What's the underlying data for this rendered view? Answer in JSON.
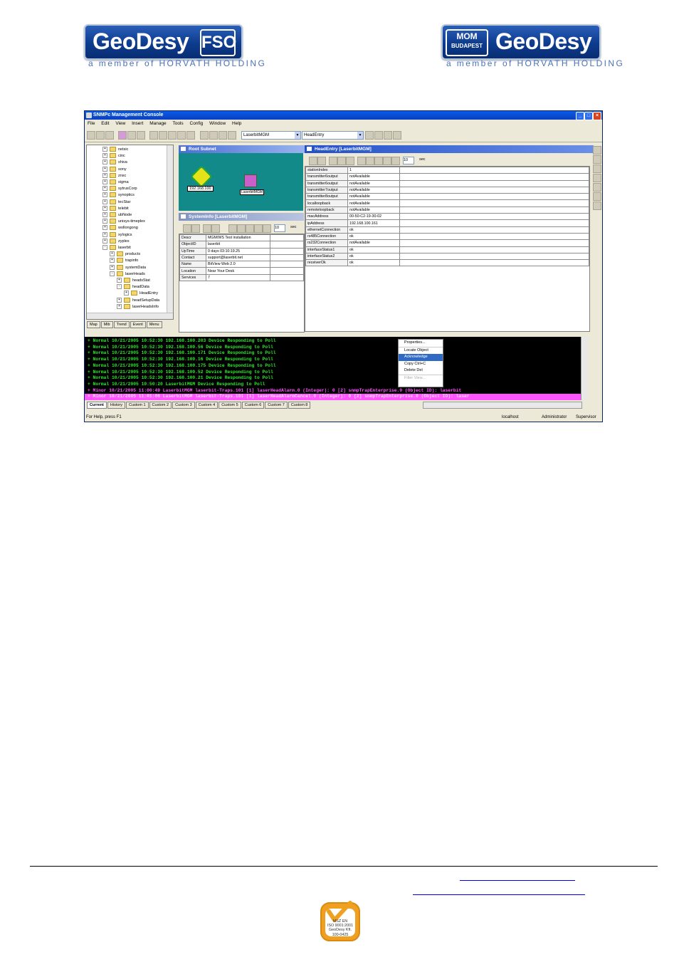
{
  "header": {
    "logo_left": {
      "word": "GeoDesy",
      "box": "FSO",
      "tagline": "a member of HORVATH HOLDING"
    },
    "logo_right": {
      "word": "GeoDesy",
      "box_top": "MOM",
      "box_bottom": "BUDAPEST",
      "tagline": "a member of HORVATH HOLDING"
    }
  },
  "window": {
    "title": "SNMPc Management Console",
    "menu": [
      "File",
      "Edit",
      "View",
      "Insert",
      "Manage",
      "Tools",
      "Config",
      "Window",
      "Help"
    ],
    "combo1": "LaserbitMGM",
    "combo2": "HeadEntry"
  },
  "tree": {
    "items": [
      {
        "label": "netsic",
        "pm": "+"
      },
      {
        "label": "cinc",
        "pm": "+"
      },
      {
        "label": "shiva",
        "pm": "+"
      },
      {
        "label": "sony",
        "pm": "+"
      },
      {
        "label": "znxc",
        "pm": "+"
      },
      {
        "label": "sigma",
        "pm": "+"
      },
      {
        "label": "sytrusCorp",
        "pm": "+"
      },
      {
        "label": "synoptics",
        "pm": "+"
      },
      {
        "label": "tecStar",
        "pm": "+"
      },
      {
        "label": "telebit",
        "pm": "+"
      },
      {
        "label": "ubNode",
        "pm": "+"
      },
      {
        "label": "unisys-timeplex",
        "pm": "+"
      },
      {
        "label": "wollongong",
        "pm": "+"
      },
      {
        "label": "xylogics",
        "pm": "+"
      },
      {
        "label": "zyplex",
        "pm": "+"
      },
      {
        "label": "laserbit",
        "pm": "-"
      },
      {
        "label": "products",
        "pm": "+"
      },
      {
        "label": "trapinfo",
        "pm": "+"
      },
      {
        "label": "systemData",
        "pm": "+"
      },
      {
        "label": "laserHeads",
        "pm": "-"
      },
      {
        "label": "headsStat",
        "pm": "+"
      },
      {
        "label": "headData",
        "pm": "-"
      },
      {
        "label": "HeadEntry",
        "pm": "+"
      },
      {
        "label": "headSetupData",
        "pm": "+"
      },
      {
        "label": "laserHeadsInfo",
        "pm": "+"
      }
    ],
    "tabs": [
      "Map",
      "Mib",
      "Trend",
      "Event",
      "Menu"
    ]
  },
  "root_subnet": {
    "title": "Root Subnet",
    "node1": "192.168.100",
    "node2": "LaserbitMGM"
  },
  "system_info": {
    "title": "SystemInfo [LaserbitMGM]",
    "poll": "10",
    "unit": "sec",
    "rows": [
      {
        "k": "Descr",
        "v": "MGM/WS Test installation"
      },
      {
        "k": "ObjectID",
        "v": "laserbit"
      },
      {
        "k": "UpTime",
        "v": "0 days 03:10:19.25"
      },
      {
        "k": "Contact",
        "v": "support@laserbit.net"
      },
      {
        "k": "Name",
        "v": "BitView Web 2.0"
      },
      {
        "k": "Location",
        "v": "Near Your Desk"
      },
      {
        "k": "Services",
        "v": "7"
      }
    ]
  },
  "head_entry": {
    "title": "HeadEntry [LaserbitMGM]",
    "poll": "10",
    "unit": "sec",
    "rows": [
      {
        "k": "stationIndex",
        "v": "1"
      },
      {
        "k": "transmitter6output",
        "v": "notAvailable"
      },
      {
        "k": "transmitter6output",
        "v": "notAvailable"
      },
      {
        "k": "transmitter7output",
        "v": "notAvailable"
      },
      {
        "k": "transmitter8output",
        "v": "notAvailable"
      },
      {
        "k": "localloopback",
        "v": "notAvailable"
      },
      {
        "k": "remoteloopback",
        "v": "notAvailable"
      },
      {
        "k": "macAddress",
        "v": "00-50-C2-19-30-02"
      },
      {
        "k": "ipAddress",
        "v": "192.168.100.161"
      },
      {
        "k": "ethernetConnection",
        "v": "ok"
      },
      {
        "k": "rs485Connection",
        "v": "ok"
      },
      {
        "k": "rs232Connection",
        "v": "notAvailable"
      },
      {
        "k": "interfaceStatus1",
        "v": "ok"
      },
      {
        "k": "interfaceStatus2",
        "v": "ok"
      },
      {
        "k": "receiverOk",
        "v": "ok"
      }
    ]
  },
  "log": {
    "rows": [
      {
        "c": "#2ee82e",
        "t": "+ Normal     10/21/2005   10:52:30   192.168.100.203    Device Responding to Poll"
      },
      {
        "c": "#2ee82e",
        "t": "+ Normal     10/21/2005   10:52:30   192.168.100.56     Device Responding to Poll"
      },
      {
        "c": "#2ee82e",
        "t": "+ Normal     10/21/2005   10:52:30   192.168.100.171    Device Responding to Poll"
      },
      {
        "c": "#2ee82e",
        "t": "+ Normal     10/21/2005   10:52:30   192.168.100.16     Device Responding to Poll"
      },
      {
        "c": "#2ee82e",
        "t": "+ Normal     10/21/2005   10:52:30   192.168.100.175    Device Responding to Poll"
      },
      {
        "c": "#2ee82e",
        "t": "+ Normal     10/21/2005   10:52:30   192.168.100.52     Device Responding to Poll"
      },
      {
        "c": "#2ee82e",
        "t": "+ Normal     10/21/2005   10:52:30   192.168.100.21     Device Responding to Poll"
      },
      {
        "c": "#2ee82e",
        "t": "+ Normal     10/21/2005   10:50:20   LaserbitMGM        Device Responding to Poll"
      },
      {
        "c": "#ff55ff",
        "t": "+ Minor      10/21/2005   11:00:49   LaserbitMGM        laserbit-Traps.101 [1] laserHeadAlarm.0 (Integer): 0 [2] snmpTrapEnterprise.0 (Object ID): laserbit"
      },
      {
        "c": "#ff55ff",
        "t": "+ Minor      10/21/2005   11:01:06   LaserbitMGM        laserbit-Traps.101 [1] laserHeadAlarmCancel.0 (Integer): 0 [2] snmpTrapEnterprise.0 (Object ID): laser"
      }
    ],
    "context_menu": [
      "Properties...",
      "Locate Object",
      "Acknowledge",
      "Copy    Ctrl+C",
      "Delete      Del",
      "Filter View..."
    ],
    "tabs": [
      "Current",
      "History",
      "Custom 1",
      "Custom 2",
      "Custom 3",
      "Custom 4",
      "Custom 5",
      "Custom 6",
      "Custom 7",
      "Custom 8"
    ]
  },
  "status": {
    "help": "For Help, press F1",
    "host": "localhost",
    "user": "Administrator",
    "role": "Supervisor"
  },
  "cert": {
    "line1": "MSZ EN",
    "line2": "ISO 9001:2001",
    "line3": "GeoDesy Kft.",
    "line4": "100-0425"
  },
  "colors": {
    "brand_blue": "#0d3b8e",
    "log_green": "#2ee82e",
    "log_magenta": "#ff55ff",
    "cert_orange": "#f0a020"
  }
}
